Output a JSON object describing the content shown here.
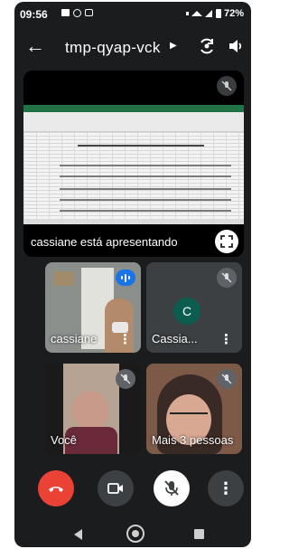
{
  "status_bar": {
    "time": "09:56",
    "battery": "72%",
    "icons": [
      "photo-icon",
      "whatsapp-icon",
      "cast-icon",
      "vibrate-icon",
      "wifi-icon",
      "signal-icon",
      "battery-icon"
    ]
  },
  "meeting": {
    "code": "tmp-qyap-vck",
    "icons": {
      "back": "arrow-left-icon",
      "switch_camera": "switch-camera-icon",
      "audio": "speaker-icon"
    }
  },
  "presentation": {
    "label": "cassiane está apresentando",
    "mic_state": "muted"
  },
  "participants": [
    {
      "name": "cassiane",
      "status": "speaking"
    },
    {
      "name": "Cassia...",
      "avatar_letter": "C",
      "status": "muted"
    },
    {
      "name": "Você",
      "status": "muted"
    },
    {
      "name": "Mais 3 pessoas",
      "status": "muted"
    }
  ],
  "controls": {
    "end_call_color": "#ea4335",
    "mic_state": "muted",
    "items": [
      "end-call-icon",
      "camera-icon",
      "mic-off-icon",
      "more-options-icon"
    ]
  },
  "colors": {
    "background": "#1b1c1e",
    "tile": "#3c4043",
    "accent_speaking": "#1a73e8",
    "avatar": "#0b5e4f"
  }
}
